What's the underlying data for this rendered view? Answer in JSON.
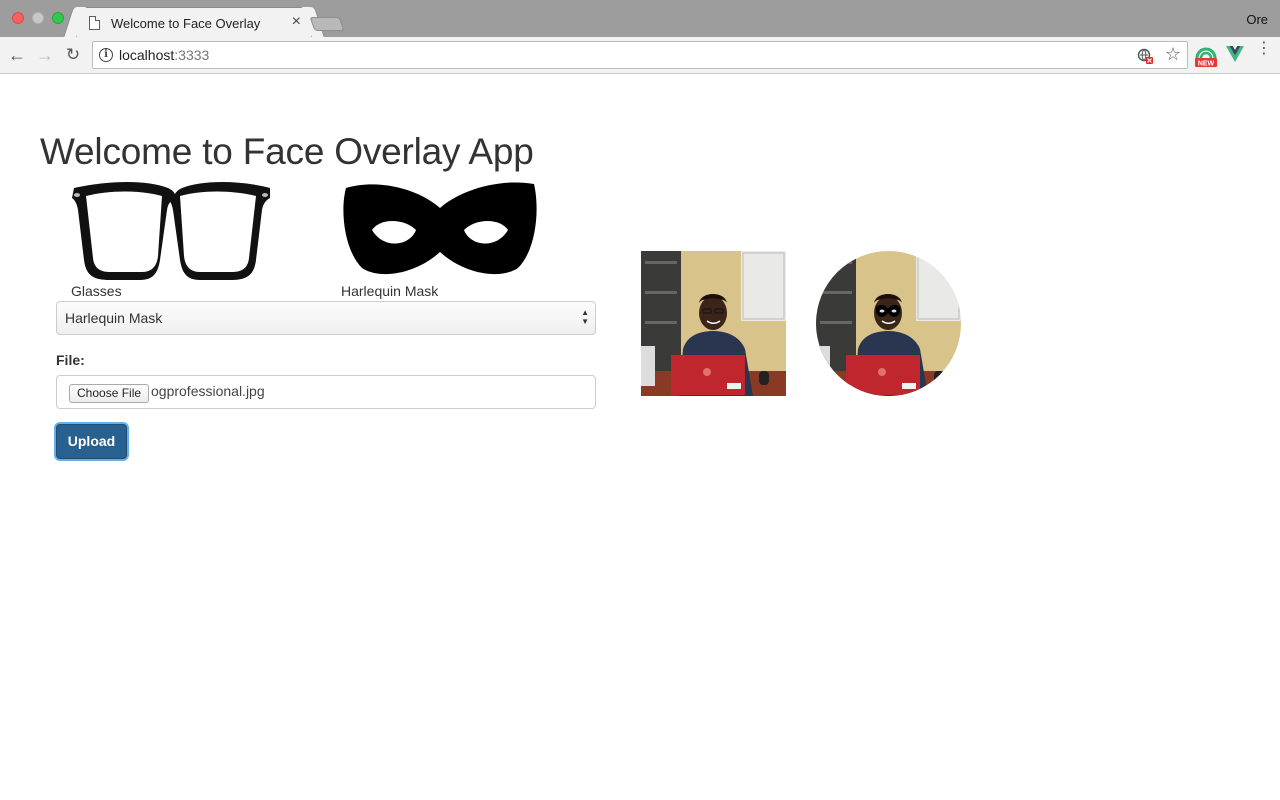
{
  "browser": {
    "tab_title": "Welcome to Face Overlay",
    "tab_close": "×",
    "profile_name": "Ore",
    "url_host": "localhost",
    "url_port": ":3333",
    "back_icon": "←",
    "forward_icon": "→",
    "reload_icon": "↻",
    "info_icon": "i",
    "star_icon": "☆",
    "menu_icon": "⋮",
    "ext_badge": "NEW"
  },
  "page": {
    "title": "Welcome to Face Overlay App",
    "overlays": [
      {
        "label": "Glasses",
        "icon": "glasses-icon"
      },
      {
        "label": "Harlequin Mask",
        "icon": "harlequin-mask-icon"
      }
    ],
    "select": {
      "value": "Harlequin Mask"
    },
    "file": {
      "label": "File:",
      "button": "Choose File",
      "filename": "ogprofessional.jpg"
    },
    "upload_button": "Upload",
    "images": [
      {
        "name": "original-photo",
        "shape": "square"
      },
      {
        "name": "overlay-result-photo",
        "shape": "circle"
      }
    ]
  },
  "colors": {
    "primary_button": "#286090",
    "title_text": "#333333",
    "laptop_red": "#c0262d",
    "hoodie_navy": "#2a3550"
  }
}
